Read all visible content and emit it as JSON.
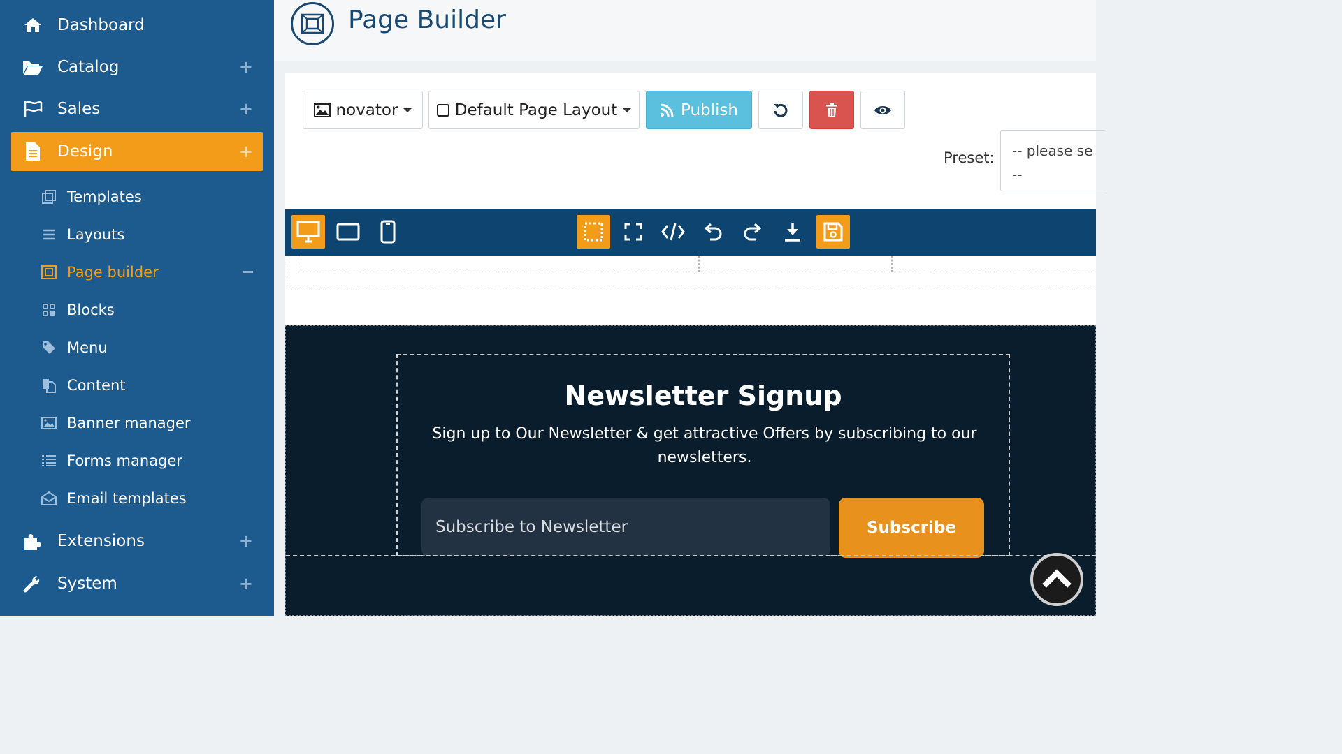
{
  "sidebar": {
    "items": [
      {
        "label": "Dashboard",
        "icon": "home-icon"
      },
      {
        "label": "Catalog",
        "icon": "folder-open-icon",
        "expand": "+"
      },
      {
        "label": "Sales",
        "icon": "flag-icon",
        "expand": "+"
      },
      {
        "label": "Design",
        "icon": "file-text-icon",
        "expand": "+",
        "active": true
      },
      {
        "label": "Extensions",
        "icon": "puzzle-icon",
        "expand": "+"
      },
      {
        "label": "System",
        "icon": "wrench-icon",
        "expand": "+"
      }
    ],
    "subitems": [
      {
        "label": "Templates",
        "icon": "templates-icon"
      },
      {
        "label": "Layouts",
        "icon": "list-icon"
      },
      {
        "label": "Page builder",
        "icon": "page-builder-icon",
        "active": true
      },
      {
        "label": "Blocks",
        "icon": "grid-icon"
      },
      {
        "label": "Menu",
        "icon": "tag-icon"
      },
      {
        "label": "Content",
        "icon": "copy-icon"
      },
      {
        "label": "Banner manager",
        "icon": "image-icon"
      },
      {
        "label": "Forms manager",
        "icon": "list-alt-icon"
      },
      {
        "label": "Email templates",
        "icon": "envelope-open-icon"
      }
    ]
  },
  "header": {
    "title": "Page Builder",
    "icon": "page-builder-icon"
  },
  "toolbar": {
    "template_select": "novator",
    "layout_select": "Default Page Layout",
    "publish_label": "Publish",
    "preset_label": "Preset:",
    "preset_value_line1": "-- please se",
    "preset_value_line2": "--"
  },
  "editor_toolbar": {
    "devices": [
      "desktop-icon",
      "tablet-icon",
      "mobile-icon"
    ],
    "tools": [
      "select-area-icon",
      "fullscreen-icon",
      "code-icon",
      "undo-icon",
      "redo-icon",
      "download-icon",
      "save-icon"
    ]
  },
  "canvas": {
    "newsletter": {
      "title": "Newsletter Signup",
      "text": "Sign up to Our Newsletter & get attractive Offers by subscribing to our newsletters.",
      "input_placeholder": "Subscribe to Newsletter",
      "button_label": "Subscribe"
    }
  },
  "colors": {
    "sidebar_bg": "#1d5a8e",
    "accent": "#f39c1a",
    "header_text": "#1a4a74",
    "publish": "#5bc0de",
    "delete": "#d9534f",
    "toolbar_bg": "#0e4570",
    "canvas_dark": "#0a1d2d"
  }
}
